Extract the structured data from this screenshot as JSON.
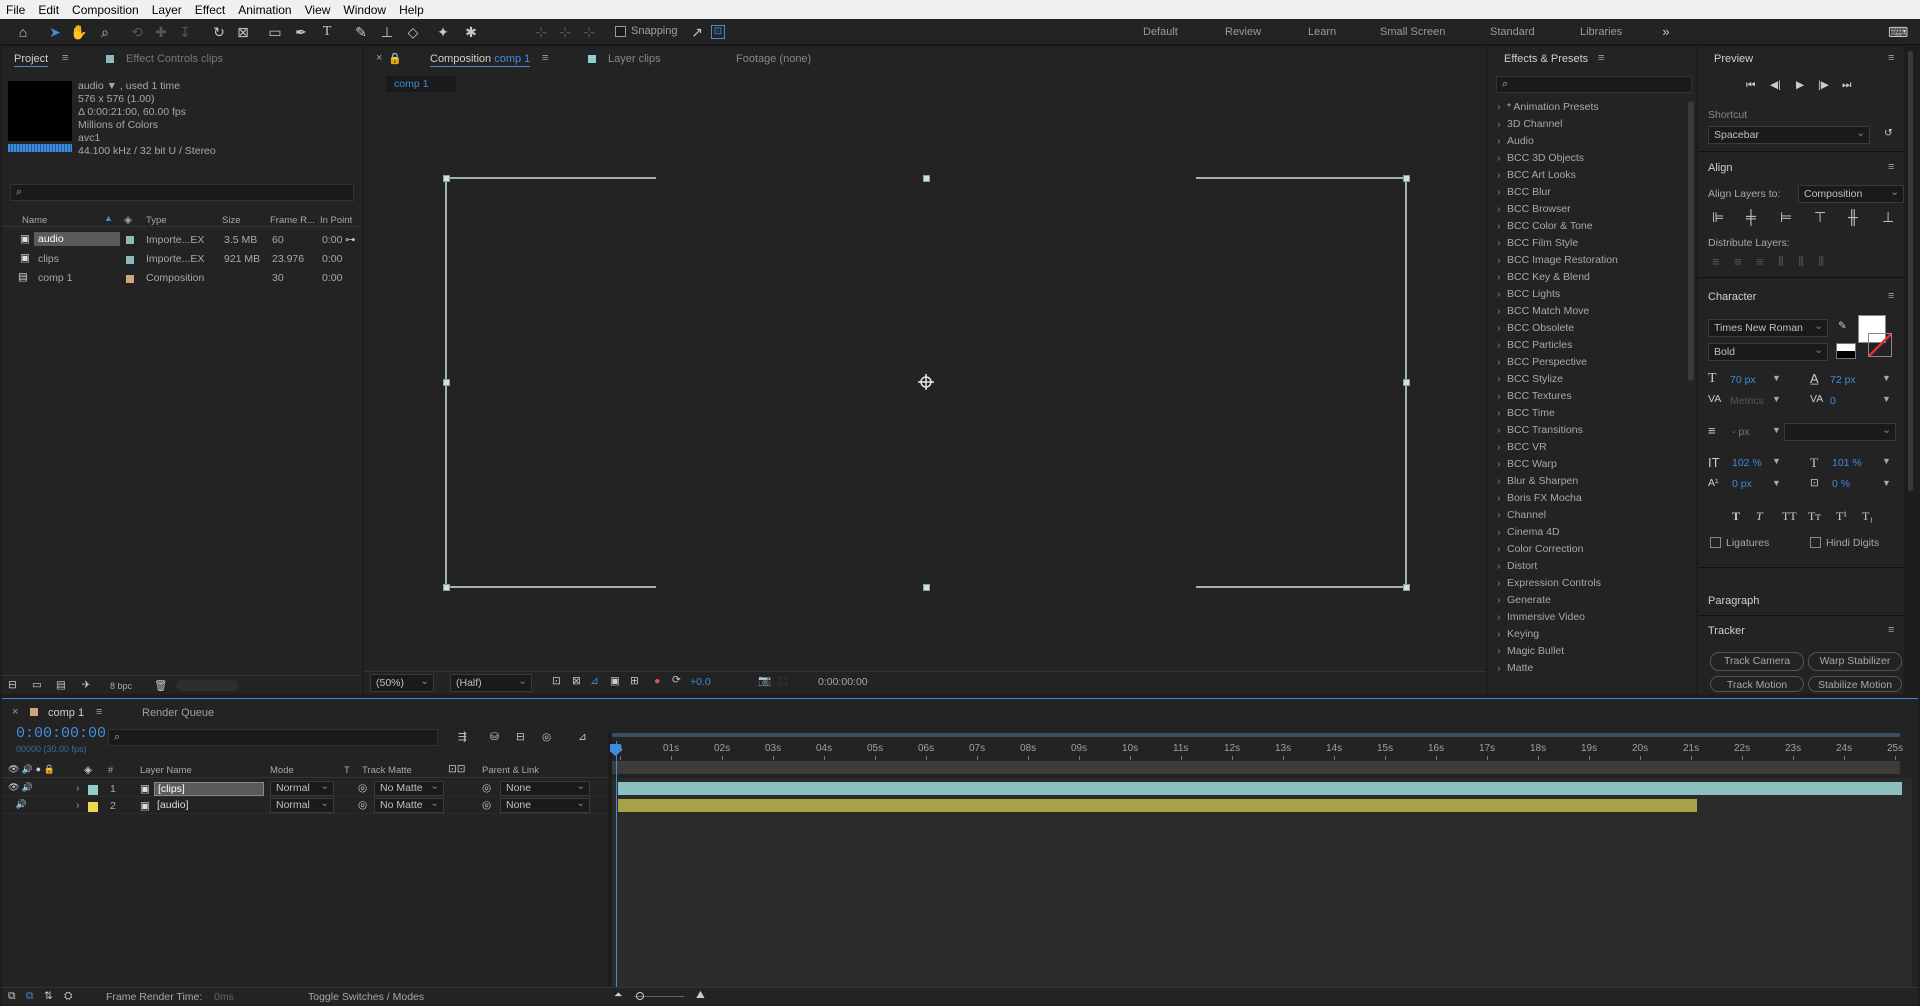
{
  "menu": [
    "File",
    "Edit",
    "Composition",
    "Layer",
    "Effect",
    "Animation",
    "View",
    "Window",
    "Help"
  ],
  "toolbar": {
    "snapping": "Snapping"
  },
  "workspaces": [
    "Default",
    "Review",
    "Learn",
    "Small Screen",
    "Standard",
    "Libraries"
  ],
  "project": {
    "tab_project": "Project",
    "tab_effect_controls": "Effect Controls clips",
    "info": {
      "name": "audio ▼ , used 1 time",
      "size": "576 x 576 (1.00)",
      "duration": "Δ 0:00:21:00, 60.00 fps",
      "colors": "Millions of Colors",
      "codec": "avc1",
      "audio": "44.100 kHz / 32 bit U / Stereo"
    },
    "columns": [
      "Name",
      "Type",
      "Size",
      "Frame R...",
      "In Point"
    ],
    "items": [
      {
        "name": "audio",
        "type": "Importe...EX",
        "size": "3.5 MB",
        "fps": "60",
        "in": "0:00",
        "color": "#8fb8b8"
      },
      {
        "name": "clips",
        "type": "Importe...EX",
        "size": "921 MB",
        "fps": "23.976",
        "in": "0:00",
        "color": "#8fb8b8"
      },
      {
        "name": "comp 1",
        "type": "Composition",
        "size": "",
        "fps": "30",
        "in": "0:00",
        "color": "#c8a878"
      }
    ],
    "bpc": "8 bpc"
  },
  "viewer": {
    "tab_composition": "Composition",
    "tab_composition_name": "comp 1",
    "tab_layer": "Layer clips",
    "tab_footage": "Footage (none)",
    "sub_tab": "comp 1",
    "zoom": "(50%)",
    "resolution": "(Half)",
    "exposure": "+0.0",
    "timecode": "0:00:00:00"
  },
  "effects": {
    "title": "Effects & Presets",
    "list": [
      "* Animation Presets",
      "3D Channel",
      "Audio",
      "BCC 3D Objects",
      "BCC Art Looks",
      "BCC Blur",
      "BCC Browser",
      "BCC Color & Tone",
      "BCC Film Style",
      "BCC Image Restoration",
      "BCC Key & Blend",
      "BCC Lights",
      "BCC Match Move",
      "BCC Obsolete",
      "BCC Particles",
      "BCC Perspective",
      "BCC Stylize",
      "BCC Textures",
      "BCC Time",
      "BCC Transitions",
      "BCC VR",
      "BCC Warp",
      "Blur & Sharpen",
      "Boris FX Mocha",
      "Channel",
      "Cinema 4D",
      "Color Correction",
      "Distort",
      "Expression Controls",
      "Generate",
      "Immersive Video",
      "Keying",
      "Magic Bullet",
      "Matte"
    ]
  },
  "preview": {
    "title": "Preview",
    "shortcut_label": "Shortcut",
    "shortcut_value": "Spacebar"
  },
  "align": {
    "title": "Align",
    "align_to_label": "Align Layers to:",
    "align_to_value": "Composition",
    "distribute_label": "Distribute Layers:"
  },
  "character": {
    "title": "Character",
    "font": "Times New Roman",
    "style": "Bold",
    "size": "70 px",
    "leading": "72 px",
    "kerning": "Metrics",
    "tracking": "0",
    "stroke": "- px",
    "vscale": "102 %",
    "hscale": "101 %",
    "baseline": "0 px",
    "tsume": "0 %",
    "ligatures": "Ligatures",
    "hindi": "Hindi Digits"
  },
  "paragraph": {
    "title": "Paragraph"
  },
  "tracker": {
    "title": "Tracker",
    "buttons": [
      "Track Camera",
      "Warp Stabilizer",
      "Track Motion",
      "Stabilize Motion"
    ]
  },
  "timeline": {
    "tab_comp": "comp 1",
    "tab_render": "Render Queue",
    "timecode": "0:00:00:00",
    "fps": "00000 (30.00 fps)",
    "columns": {
      "layer_name": "Layer Name",
      "mode": "Mode",
      "t": "T",
      "track_matte": "Track Matte",
      "parent": "Parent & Link"
    },
    "layers": [
      {
        "num": "1",
        "name": "[clips]",
        "mode": "Normal",
        "matte": "No Matte",
        "parent": "None",
        "label": "#8fcfcf",
        "bar": "#8cbfbf",
        "end": 1.0
      },
      {
        "num": "2",
        "name": "[audio]",
        "mode": "Normal",
        "matte": "No Matte",
        "parent": "None",
        "label": "#e8d84a",
        "bar": "#a9a14a",
        "end": 0.84
      }
    ],
    "ruler": [
      "0s",
      "01s",
      "02s",
      "03s",
      "04s",
      "05s",
      "06s",
      "07s",
      "08s",
      "09s",
      "10s",
      "11s",
      "12s",
      "13s",
      "14s",
      "15s",
      "16s",
      "17s",
      "18s",
      "19s",
      "20s",
      "21s",
      "22s",
      "23s",
      "24s",
      "25s"
    ],
    "footer_render": "Frame Render Time:",
    "footer_render_value": "0ms",
    "footer_toggle": "Toggle Switches / Modes"
  },
  "colors": {
    "accent": "#3f8cdc",
    "bg": "#1d1d1d",
    "panel": "#232323"
  }
}
